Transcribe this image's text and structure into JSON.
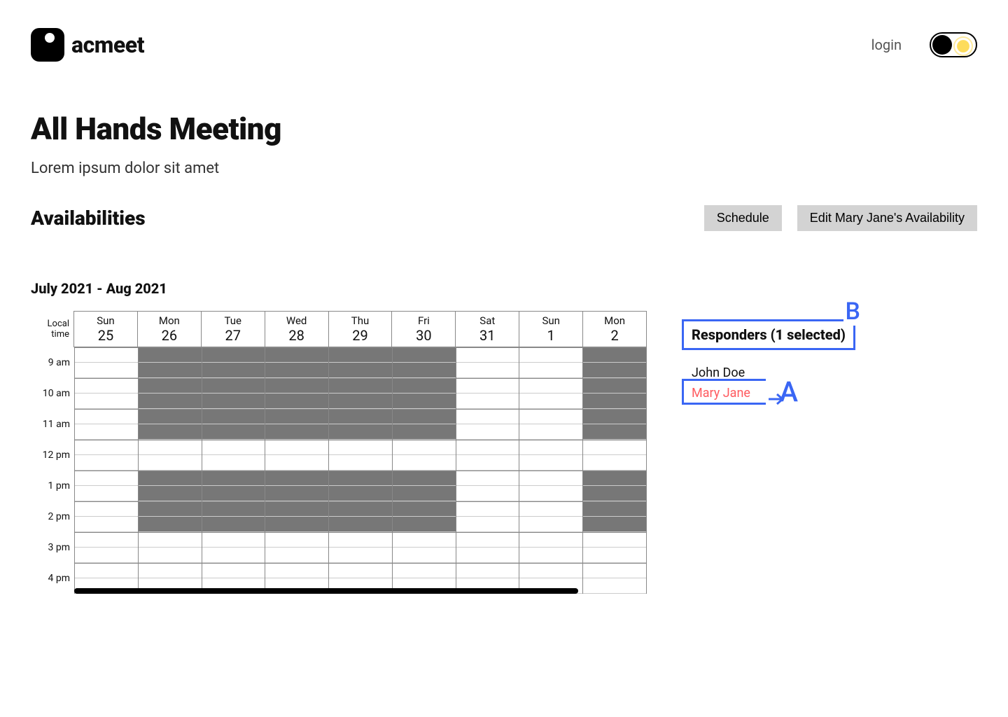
{
  "brand": {
    "name": "acmeet"
  },
  "header": {
    "login_label": "login"
  },
  "meeting": {
    "title": "All Hands Meeting",
    "description": "Lorem ipsum dolor sit amet"
  },
  "availabilities": {
    "heading": "Availabilities",
    "schedule_label": "Schedule",
    "edit_label": "Edit Mary Jane's Availability",
    "range_label": "July 2021 - Aug  2021"
  },
  "grid": {
    "time_col_label_line1": "Local",
    "time_col_label_line2": "time",
    "days": [
      {
        "dow": "Sun",
        "date": "25"
      },
      {
        "dow": "Mon",
        "date": "26"
      },
      {
        "dow": "Tue",
        "date": "27"
      },
      {
        "dow": "Wed",
        "date": "28"
      },
      {
        "dow": "Thu",
        "date": "29"
      },
      {
        "dow": "Fri",
        "date": "30"
      },
      {
        "dow": "Sat",
        "date": "31"
      },
      {
        "dow": "Sun",
        "date": "1"
      },
      {
        "dow": "Mon",
        "date": "2"
      }
    ],
    "times": [
      "9 am",
      "10 am",
      "11 am",
      "12 pm",
      "1 pm",
      "2 pm",
      "3 pm",
      "4 pm"
    ],
    "busy_days": {
      "1": true,
      "2": true,
      "3": true,
      "4": true,
      "5": true,
      "8": true
    },
    "busy_rows": {
      "0": true,
      "1": true,
      "2": true,
      "3": true,
      "4": true,
      "5": true,
      "8": true,
      "9": true,
      "10": true,
      "11": true
    }
  },
  "responders": {
    "title": "Responders  (1 selected)",
    "items": [
      {
        "name": "John Doe",
        "selected": false
      },
      {
        "name": "Mary Jane",
        "selected": true
      }
    ]
  },
  "callouts": {
    "A": "A",
    "B": "B"
  }
}
